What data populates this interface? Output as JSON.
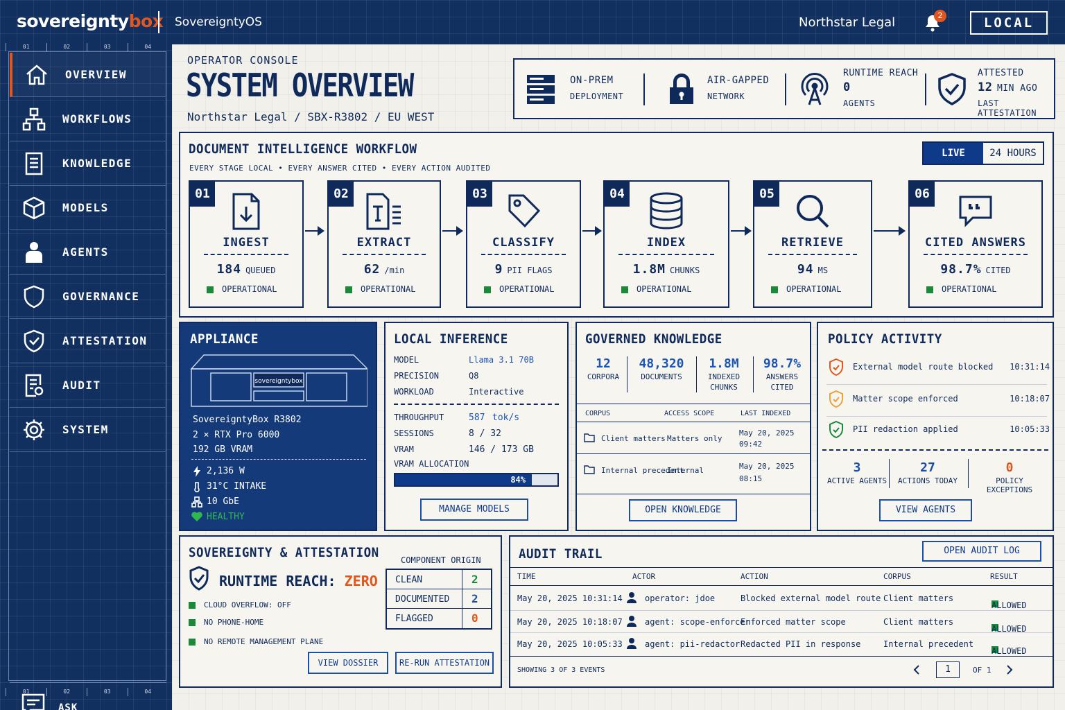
{
  "header": {
    "logo_part1": "sovereignty",
    "logo_part2": "box",
    "os_name": "SovereigntyOS",
    "client": "Northstar Legal",
    "notifications": "2",
    "mode": "LOCAL"
  },
  "sidebar": {
    "ruler": [
      "01",
      "02",
      "03",
      "04"
    ],
    "items": [
      {
        "label": "OVERVIEW",
        "icon": "home-icon"
      },
      {
        "label": "WORKFLOWS",
        "icon": "workflow-icon"
      },
      {
        "label": "KNOWLEDGE",
        "icon": "document-icon"
      },
      {
        "label": "MODELS",
        "icon": "cube-icon"
      },
      {
        "label": "AGENTS",
        "icon": "agent-icon"
      },
      {
        "label": "GOVERNANCE",
        "icon": "shield-icon"
      },
      {
        "label": "ATTESTATION",
        "icon": "shield-check-icon"
      },
      {
        "label": "AUDIT",
        "icon": "audit-icon"
      },
      {
        "label": "SYSTEM",
        "icon": "gear-icon"
      }
    ],
    "ask": "ASK SOVEREIGNTYOS"
  },
  "page": {
    "eyebrow": "OPERATOR CONSOLE",
    "title": "SYSTEM OVERVIEW",
    "breadcrumb": "Northstar Legal  /  SBX-R3802  /  EU WEST"
  },
  "status": {
    "deploy_1": "ON-PREM",
    "deploy_2": "DEPLOYMENT",
    "net_1": "AIR-GAPPED",
    "net_2": "NETWORK",
    "reach_1": "RUNTIME REACH",
    "reach_2": "0",
    "reach_3": "AGENTS",
    "att_1": "ATTESTED",
    "att_2": "12",
    "att_2b": "MIN AGO",
    "att_3": "LAST ATTESTATION"
  },
  "workflow": {
    "title": "DOCUMENT INTELLIGENCE WORKFLOW",
    "subtitle": "EVERY STAGE LOCAL  •  EVERY ANSWER CITED  •  EVERY ACTION AUDITED",
    "toggle_live": "LIVE",
    "toggle_24": "24 HOURS",
    "stages": [
      {
        "num": "01",
        "name": "INGEST",
        "value": "184",
        "unit": "QUEUED",
        "status": "OPERATIONAL"
      },
      {
        "num": "02",
        "name": "EXTRACT",
        "value": "62",
        "unit": "/min",
        "status": "OPERATIONAL"
      },
      {
        "num": "03",
        "name": "CLASSIFY",
        "value": "9",
        "unit": "PII FLAGS",
        "status": "OPERATIONAL"
      },
      {
        "num": "04",
        "name": "INDEX",
        "value": "1.8M",
        "unit": "CHUNKS",
        "status": "OPERATIONAL"
      },
      {
        "num": "05",
        "name": "RETRIEVE",
        "value": "94",
        "unit": "MS",
        "status": "OPERATIONAL"
      },
      {
        "num": "06",
        "name": "CITED ANSWERS",
        "value": "98.7%",
        "unit": "CITED",
        "status": "OPERATIONAL"
      }
    ]
  },
  "appliance": {
    "title": "APPLIANCE",
    "brand": "sovereigntybox",
    "model": "SovereigntyBox R3802",
    "gpu": "2 × RTX Pro 6000",
    "vram": "192 GB VRAM",
    "power": "2,136 W",
    "temp": "31°C INTAKE",
    "net": "10 GbE",
    "health": "HEALTHY"
  },
  "inference": {
    "title": "LOCAL INFERENCE",
    "model_k": "MODEL",
    "model_v": "Llama 3.1 70B",
    "prec_k": "PRECISION",
    "prec_v": "Q8",
    "work_k": "WORKLOAD",
    "work_v": "Interactive",
    "thr_k": "THROUGHPUT",
    "thr_v": "587",
    "thr_u": "tok/s",
    "sess_k": "SESSIONS",
    "sess_v": "8  /  32",
    "vram_k": "VRAM",
    "vram_v": "146  /  173 GB",
    "alloc_k": "VRAM ALLOCATION",
    "alloc_pct": 0.84,
    "alloc_label": "84%",
    "button": "MANAGE MODELS"
  },
  "knowledge": {
    "title": "GOVERNED KNOWLEDGE",
    "stats": [
      {
        "n": "12",
        "l1": "CORPORA",
        "l2": ""
      },
      {
        "n": "48,320",
        "l1": "DOCUMENTS",
        "l2": ""
      },
      {
        "n": "1.8M",
        "l1": "INDEXED",
        "l2": "CHUNKS"
      },
      {
        "n": "98.7%",
        "l1": "ANSWERS",
        "l2": "CITED"
      }
    ],
    "headers": [
      "CORPUS",
      "ACCESS SCOPE",
      "LAST INDEXED"
    ],
    "rows": [
      {
        "corpus": "Client matters",
        "scope": "Matters only",
        "d1": "May 20, 2025",
        "d2": "09:42"
      },
      {
        "corpus": "Internal precedent",
        "scope": "Internal",
        "d1": "May 20, 2025",
        "d2": "08:15"
      }
    ],
    "button": "OPEN KNOWLEDGE"
  },
  "policy": {
    "title": "POLICY ACTIVITY",
    "events": [
      {
        "text": "External model route blocked",
        "time": "10:31:14",
        "color": "#e0561f"
      },
      {
        "text": "Matter scope enforced",
        "time": "10:18:07",
        "color": "#e8a33a"
      },
      {
        "text": "PII redaction applied",
        "time": "10:05:33",
        "color": "#1a8a3a"
      }
    ],
    "counts": [
      {
        "n": "3",
        "l": "ACTIVE AGENTS",
        "color": "#1d4fa0"
      },
      {
        "n": "27",
        "l": "ACTIONS TODAY",
        "color": "#1d4fa0"
      },
      {
        "n": "0",
        "l": "POLICY EXCEPTIONS",
        "color": "#e0561f"
      }
    ],
    "button": "VIEW AGENTS"
  },
  "sovereignty": {
    "title": "SOVEREIGNTY & ATTESTATION",
    "reach_label": "RUNTIME REACH:",
    "reach_value": "ZERO",
    "checks": [
      "CLOUD OVERFLOW: OFF",
      "NO PHONE-HOME",
      "NO REMOTE MANAGEMENT PLANE"
    ],
    "origin_title": "COMPONENT ORIGIN",
    "origin": [
      {
        "k": "CLEAN",
        "v": "2",
        "color": "#1a8a3a"
      },
      {
        "k": "DOCUMENTED",
        "v": "2",
        "color": "#1d4fa0"
      },
      {
        "k": "FLAGGED",
        "v": "0",
        "color": "#e0561f"
      }
    ],
    "btn_dossier": "VIEW DOSSIER",
    "btn_rerun": "RE-RUN ATTESTATION"
  },
  "audit": {
    "title": "AUDIT TRAIL",
    "button": "OPEN AUDIT LOG",
    "headers": [
      "TIME",
      "ACTOR",
      "ACTION",
      "CORPUS",
      "RESULT"
    ],
    "rows": [
      {
        "time": "May 20, 2025 10:31:14",
        "actor": "operator: jdoe",
        "action": "Blocked external model route",
        "corpus": "Client matters",
        "result": "ALLOWED"
      },
      {
        "time": "May 20, 2025 10:18:07",
        "actor": "agent: scope-enforcer",
        "action": "Enforced matter scope",
        "corpus": "Client matters",
        "result": "ALLOWED"
      },
      {
        "time": "May 20, 2025 10:05:33",
        "actor": "agent: pii-redactor",
        "action": "Redacted PII in response",
        "corpus": "Internal precedent",
        "result": "ALLOWED"
      }
    ],
    "footer": "SHOWING 3 OF 3 EVENTS",
    "page": "1",
    "of": "OF 1"
  },
  "colors": {
    "navy": "#0f2a5a",
    "accent": "#e0561f",
    "ok": "#1a8a3a",
    "blue": "#1d4fa0"
  }
}
